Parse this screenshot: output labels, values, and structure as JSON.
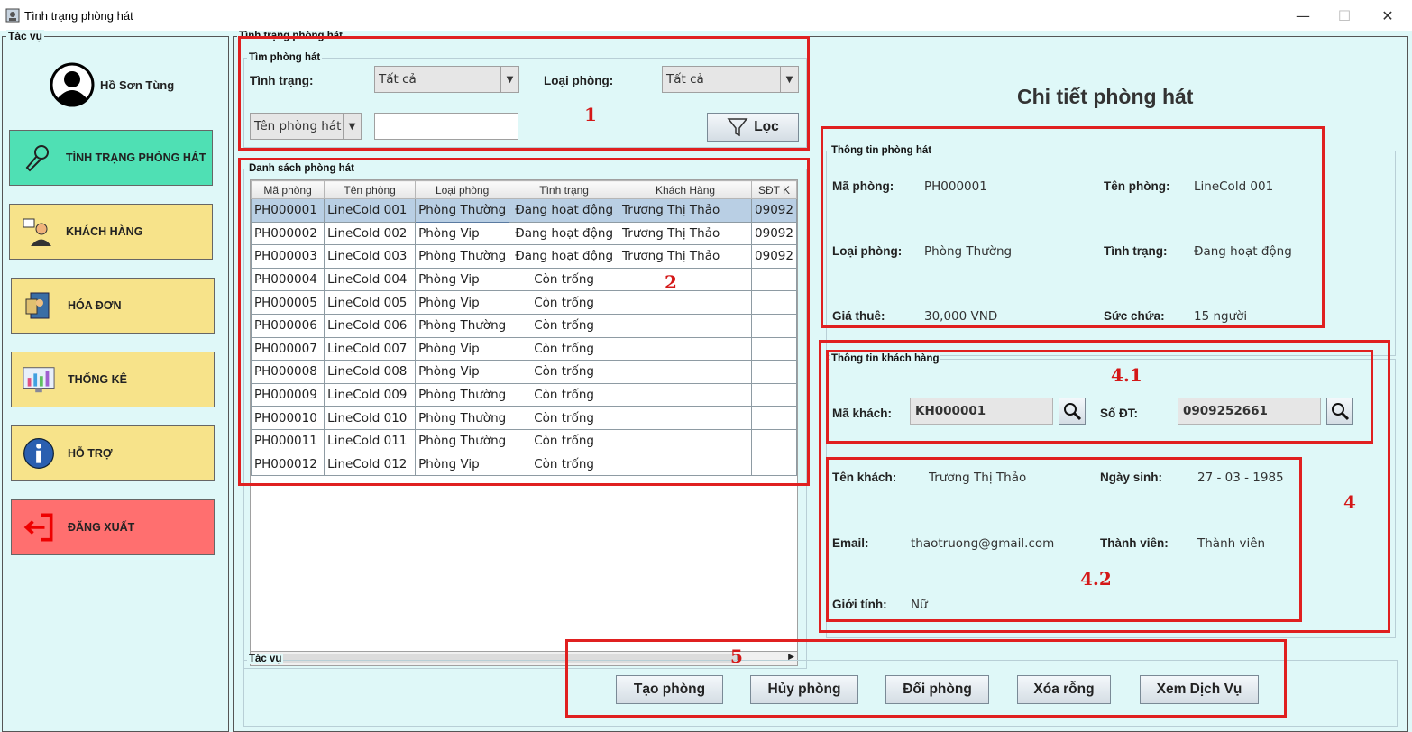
{
  "window": {
    "title": "Tình trạng phòng hát",
    "controls": [
      "—",
      "☐",
      "✕"
    ]
  },
  "sidebar": {
    "group_label": "Tác vụ",
    "user_name": "Hồ Sơn Tùng",
    "items": [
      {
        "label": "TÌNH TRẠNG PHÒNG HÁT",
        "icon": "microphone-icon",
        "color": "#4fe0b4"
      },
      {
        "label": "KHÁCH HÀNG",
        "icon": "customer-icon",
        "color": "#f7e38a"
      },
      {
        "label": "HÓA ĐƠN",
        "icon": "invoice-icon",
        "color": "#f7e38a"
      },
      {
        "label": "THỐNG KÊ",
        "icon": "statistics-icon",
        "color": "#f7e38a"
      },
      {
        "label": "HỖ TRỢ",
        "icon": "info-icon",
        "color": "#f7e38a"
      },
      {
        "label": "ĐĂNG XUẤT",
        "icon": "logout-icon",
        "color": "#ff6f6f"
      }
    ]
  },
  "room_status": {
    "group_label": "Tình trạng phòng hát",
    "search": {
      "group_label": "Tìm phòng hát",
      "status_label": "Tình trạng:",
      "status_value": "Tất cả",
      "type_label": "Loại phòng:",
      "type_value": "Tất cả",
      "field_select": "Tên phòng hát",
      "search_text": "",
      "filter_label": "Lọc"
    },
    "list": {
      "group_label": "Danh sách phòng hát",
      "columns": [
        "Mã phòng",
        "Tên phòng",
        "Loại phòng",
        "Tình trạng",
        "Khách Hàng",
        "SĐT K"
      ],
      "rows": [
        [
          "PH000001",
          "LineCold 001",
          "Phòng Thường",
          "Đang hoạt động",
          "Trương Thị Thảo",
          "09092"
        ],
        [
          "PH000002",
          "LineCold 002",
          "Phòng Vip",
          "Đang hoạt động",
          "Trương Thị Thảo",
          "09092"
        ],
        [
          "PH000003",
          "LineCold 003",
          "Phòng Thường",
          "Đang hoạt động",
          "Trương Thị Thảo",
          "09092"
        ],
        [
          "PH000004",
          "LineCold 004",
          "Phòng Vip",
          "Còn trống",
          "",
          ""
        ],
        [
          "PH000005",
          "LineCold 005",
          "Phòng Vip",
          "Còn trống",
          "",
          ""
        ],
        [
          "PH000006",
          "LineCold 006",
          "Phòng Thường",
          "Còn trống",
          "",
          ""
        ],
        [
          "PH000007",
          "LineCold 007",
          "Phòng Vip",
          "Còn trống",
          "",
          ""
        ],
        [
          "PH000008",
          "LineCold 008",
          "Phòng Vip",
          "Còn trống",
          "",
          ""
        ],
        [
          "PH000009",
          "LineCold 009",
          "Phòng Thường",
          "Còn trống",
          "",
          ""
        ],
        [
          "PH000010",
          "LineCold 010",
          "Phòng Thường",
          "Còn trống",
          "",
          ""
        ],
        [
          "PH000011",
          "LineCold 011",
          "Phòng Thường",
          "Còn trống",
          "",
          ""
        ],
        [
          "PH000012",
          "LineCold 012",
          "Phòng Vip",
          "Còn trống",
          "",
          ""
        ]
      ]
    }
  },
  "detail": {
    "title": "Chi tiết phòng hát",
    "room": {
      "group_label": "Thông tin phòng hát",
      "ma_phong_label": "Mã phòng:",
      "ma_phong": "PH000001",
      "ten_phong_label": "Tên phòng:",
      "ten_phong": "LineCold 001",
      "loai_phong_label": "Loại phòng:",
      "loai_phong": "Phòng Thường",
      "tinh_trang_label": "Tình trạng:",
      "tinh_trang": "Đang hoạt động",
      "gia_thue_label": "Giá thuê:",
      "gia_thue": "30,000 VND",
      "suc_chua_label": "Sức chứa:",
      "suc_chua": "15 người"
    },
    "customer": {
      "group_label": "Thông tin khách hàng",
      "ma_khach_label": "Mã khách:",
      "ma_khach": "KH000001",
      "so_dt_label": "Số ĐT:",
      "so_dt": "0909252661",
      "ten_khach_label": "Tên khách:",
      "ten_khach": "Trương Thị Thảo",
      "ngay_sinh_label": "Ngày sinh:",
      "ngay_sinh": "27 - 03 - 1985",
      "email_label": "Email:",
      "email": "thaotruong@gmail.com",
      "thanh_vien_label": "Thành viên:",
      "thanh_vien": "Thành viên",
      "gioi_tinh_label": "Giới tính:",
      "gioi_tinh": "Nữ"
    }
  },
  "actions": {
    "group_label": "Tác vụ",
    "buttons": [
      "Tạo phòng",
      "Hủy phòng",
      "Đổi phòng",
      "Xóa rỗng",
      "Xem Dịch Vụ"
    ]
  },
  "annotations": [
    "1",
    "2",
    "4.1",
    "4",
    "4.2",
    "5"
  ]
}
